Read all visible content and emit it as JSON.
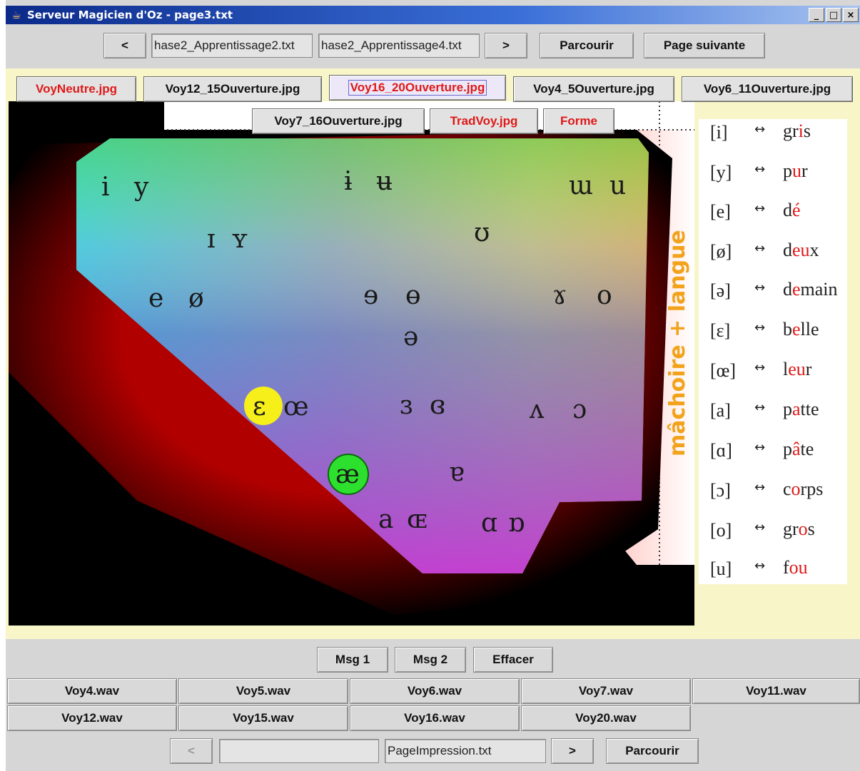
{
  "window": {
    "title": "Serveur Magicien d'Oz - page3.txt",
    "controls": [
      "_",
      "□",
      "×"
    ]
  },
  "top_bar": {
    "prev_label": "<",
    "file1": "hase2_Apprentissage2.txt",
    "file2": "hase2_Apprentissage4.txt",
    "next_label": ">",
    "browse_label": "Parcourir",
    "next_page_label": "Page suivante"
  },
  "image_tabs": {
    "row1": [
      {
        "label": "VoyNeutre.jpg",
        "color": "#e01818"
      },
      {
        "label": "Voy12_15Ouverture.jpg",
        "color": "#111111"
      },
      {
        "label": "Voy16_20Ouverture.jpg",
        "color": "#e01818",
        "selected": true
      },
      {
        "label": "Voy4_5Ouverture.jpg",
        "color": "#111111"
      },
      {
        "label": "Voy6_11Ouverture.jpg",
        "color": "#111111"
      }
    ],
    "row2": [
      {
        "label": "Voy7_16Ouverture.jpg",
        "color": "#111111"
      },
      {
        "label": "TradVoy.jpg",
        "color": "#e01818"
      },
      {
        "label": "Forme",
        "color": "#e01818"
      }
    ]
  },
  "chart": {
    "side_label": "mâchoire + langue",
    "side_label_color": "#f2a31b",
    "vowels": {
      "i": "i",
      "y": "y",
      "barred_i": "ɨ",
      "barred_u": "ʉ",
      "unrounded_u": "ɯ",
      "u": "u",
      "small_cap_i": "ɪ",
      "small_cap_y": "ʏ",
      "upsilon": "ʊ",
      "e": "e",
      "o_slash": "ø",
      "rev_e": "ɘ",
      "barred_o": "ɵ",
      "rams_horn": "ɤ",
      "o": "o",
      "schwa": "ə",
      "epsilon": "ɛ",
      "oe": "œ",
      "rev_epsilon": "ɜ",
      "closed_rev_epsilon": "ɞ",
      "caret": "ʌ",
      "open_o": "ɔ",
      "ae": "æ",
      "turned_a": "ɐ",
      "a": "a",
      "cap_oe": "ɶ",
      "script_a": "ɑ",
      "turned_script_a": "ɒ"
    },
    "highlight_yellow": "#f7ef1a",
    "highlight_green": "#2ee02e"
  },
  "legend": [
    {
      "sym": "[i]",
      "arr": "↔",
      "pre": "gr",
      "hl": "i",
      "post": "s"
    },
    {
      "sym": "[y]",
      "arr": "↔",
      "pre": "p",
      "hl": "u",
      "post": "r"
    },
    {
      "sym": "[e]",
      "arr": "↔",
      "pre": "d",
      "hl": "é",
      "post": ""
    },
    {
      "sym": "[ø]",
      "arr": "↔",
      "pre": "d",
      "hl": "eu",
      "post": "x"
    },
    {
      "sym": "[ə]",
      "arr": "↔",
      "pre": "d",
      "hl": "e",
      "post": "main"
    },
    {
      "sym": "[ɛ]",
      "arr": "↔",
      "pre": "b",
      "hl": "e",
      "post": "lle"
    },
    {
      "sym": "[œ]",
      "arr": "↔",
      "pre": "l",
      "hl": "eu",
      "post": "r"
    },
    {
      "sym": "[a]",
      "arr": "↔",
      "pre": "p",
      "hl": "a",
      "post": "tte"
    },
    {
      "sym": "[ɑ]",
      "arr": "↔",
      "pre": "p",
      "hl": "â",
      "post": "te"
    },
    {
      "sym": "[ɔ]",
      "arr": "↔",
      "pre": "c",
      "hl": "o",
      "post": "rps"
    },
    {
      "sym": "[o]",
      "arr": "↔",
      "pre": "gr",
      "hl": "o",
      "post": "s"
    },
    {
      "sym": "[u]",
      "arr": "↔",
      "pre": "f",
      "hl": "ou",
      "post": ""
    }
  ],
  "msg_bar": {
    "msg1": "Msg 1",
    "msg2": "Msg 2",
    "clear": "Effacer"
  },
  "sounds": {
    "row1": [
      "Voy4.wav",
      "Voy5.wav",
      "Voy6.wav",
      "Voy7.wav",
      "Voy11.wav"
    ],
    "row2": [
      "Voy12.wav",
      "Voy15.wav",
      "Voy16.wav",
      "Voy20.wav"
    ]
  },
  "bottom_bar": {
    "prev_label": "<",
    "file_left": "",
    "file_right": "PageImpression.txt",
    "next_label": ">",
    "browse_label": "Parcourir"
  }
}
